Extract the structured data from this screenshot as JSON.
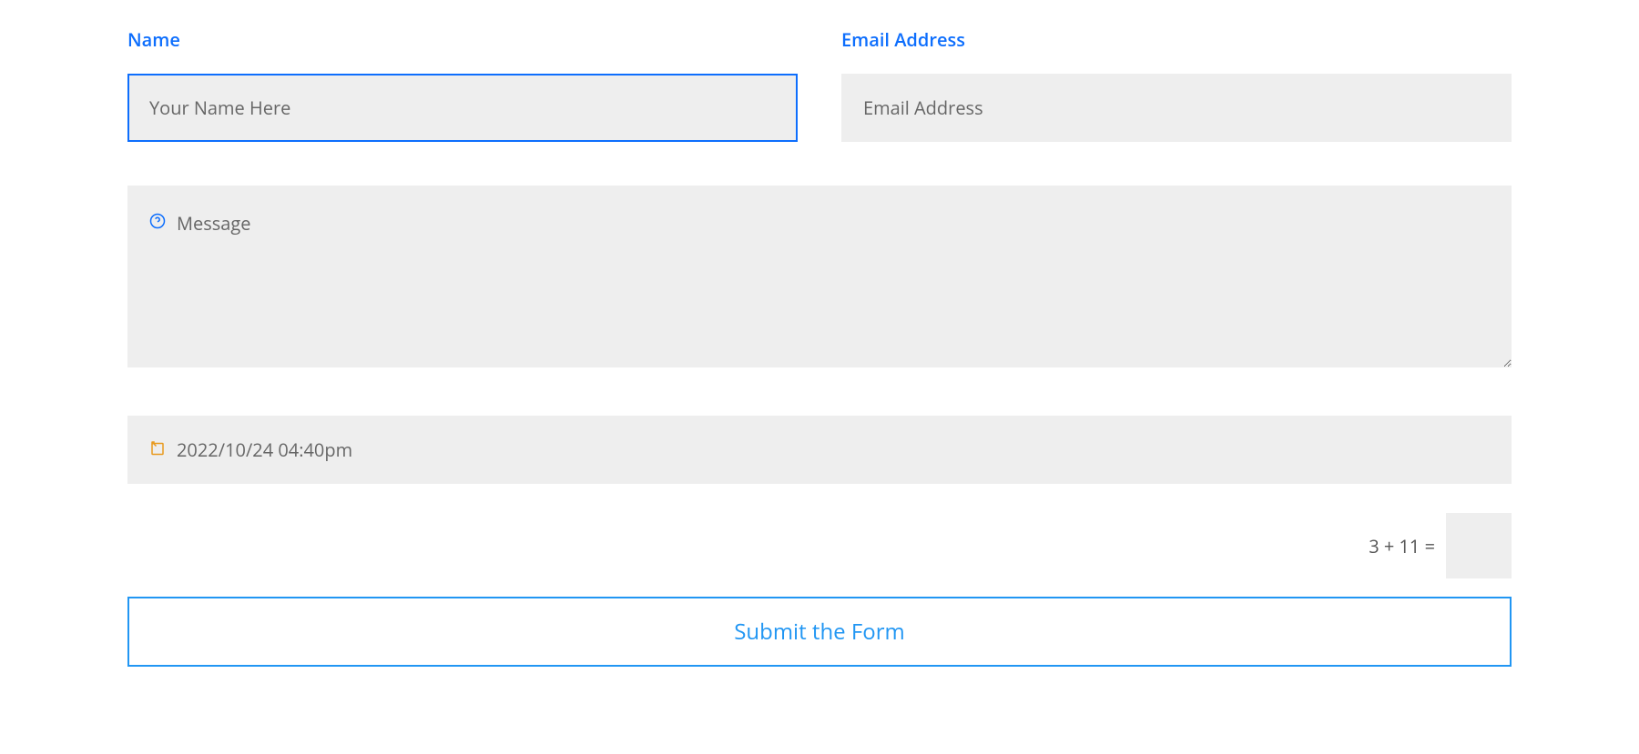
{
  "form": {
    "name": {
      "label": "Name",
      "placeholder": "Your Name Here",
      "value": ""
    },
    "email": {
      "label": "Email Address",
      "placeholder": "Email Address",
      "value": ""
    },
    "message": {
      "placeholder": "Message",
      "value": ""
    },
    "datetime": {
      "value": "2022/10/24 04:40pm"
    },
    "captcha": {
      "question": "3 + 11 =",
      "value": ""
    },
    "submit": {
      "label": "Submit the Form"
    }
  }
}
